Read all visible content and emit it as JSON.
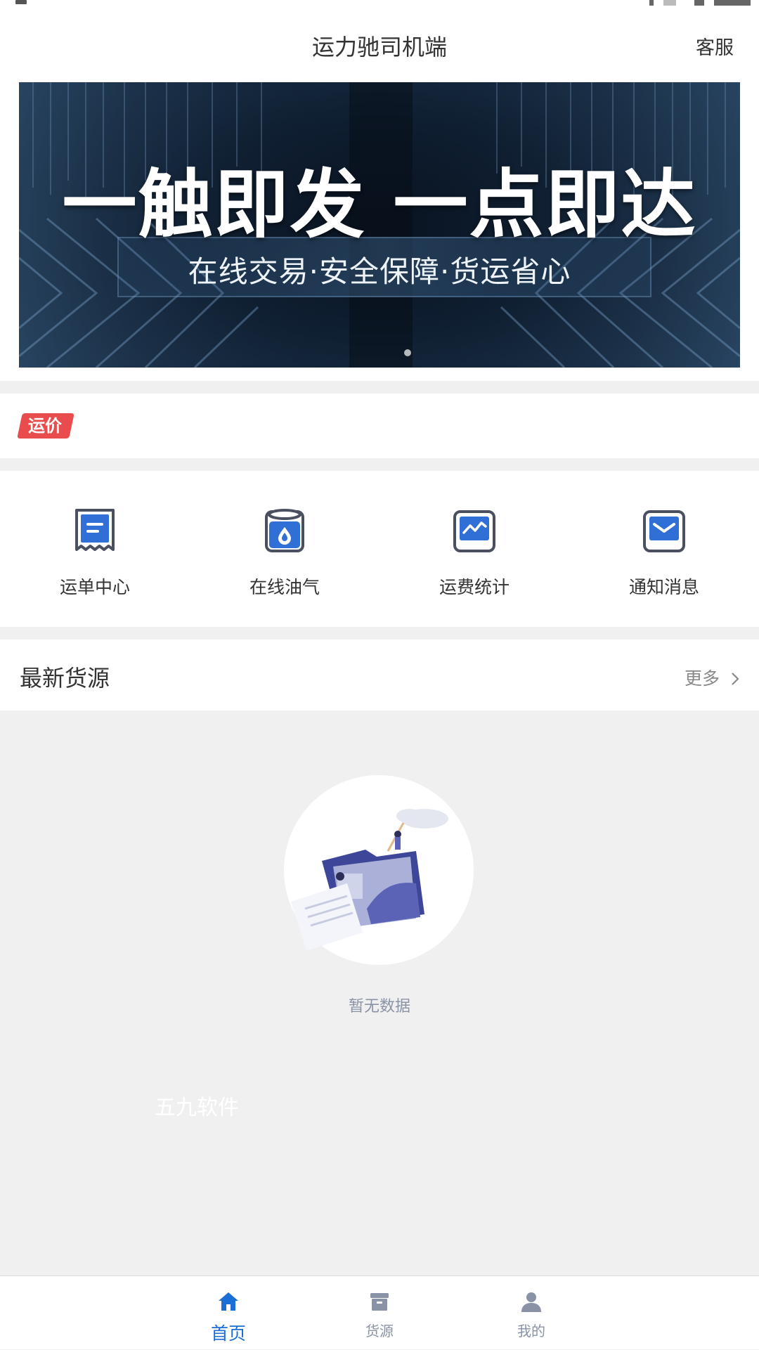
{
  "header": {
    "title": "运力驰司机端",
    "service_label": "客服"
  },
  "banner": {
    "headline": "一触即发 一点即达",
    "subtitle": "在线交易·安全保障·货运省心"
  },
  "price_tag": {
    "label": "运价",
    "color": "#e84c4c"
  },
  "quick_actions": [
    {
      "label": "运单中心",
      "icon": "receipt-icon"
    },
    {
      "label": "在线油气",
      "icon": "fuel-can-icon"
    },
    {
      "label": "运费统计",
      "icon": "chart-icon"
    },
    {
      "label": "通知消息",
      "icon": "envelope-icon"
    }
  ],
  "latest": {
    "title": "最新货源",
    "more_label": "更多"
  },
  "empty_state": {
    "text": "暂无数据"
  },
  "watermark": "五九软件",
  "tabs": [
    {
      "label": "首页",
      "icon": "home-icon",
      "active": true
    },
    {
      "label": "货源",
      "icon": "cargo-box-icon",
      "active": false
    },
    {
      "label": "我的",
      "icon": "user-icon",
      "active": false
    }
  ],
  "colors": {
    "accent": "#1a6fd6",
    "icon_blue": "#2f6fd6",
    "icon_dark": "#4a5060"
  }
}
